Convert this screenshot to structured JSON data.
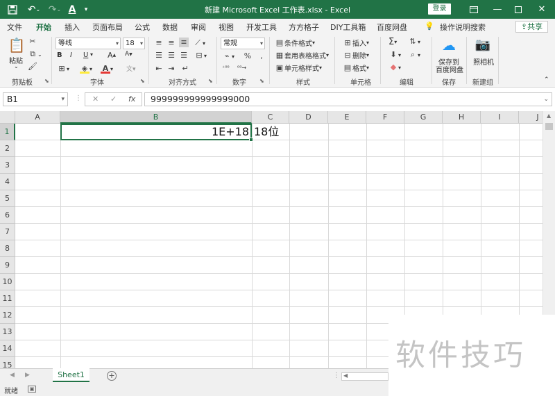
{
  "window": {
    "title": "新建 Microsoft Excel 工作表.xlsx  -  Excel",
    "login_label": "登录",
    "icons": [
      "save-icon",
      "undo-icon",
      "redo-icon",
      "font-color-icon",
      "customize-icon",
      "ribbon-display-icon",
      "minimize-icon",
      "maximize-icon",
      "close-icon"
    ]
  },
  "ribbon_tabs": [
    "文件",
    "开始",
    "插入",
    "页面布局",
    "公式",
    "数据",
    "审阅",
    "视图",
    "开发工具",
    "方方格子",
    "DIY工具箱",
    "百度网盘"
  ],
  "active_tab": "开始",
  "tell_me": "操作说明搜索",
  "share_label": "共享",
  "ribbon": {
    "clipboard": {
      "paste": "粘贴",
      "label": "剪贴板"
    },
    "font": {
      "family": "等线",
      "size": "18",
      "bold": "B",
      "italic": "I",
      "underline": "U",
      "label": "字体"
    },
    "alignment": {
      "label": "对齐方式"
    },
    "number": {
      "format": "常规",
      "label": "数字"
    },
    "styles": {
      "conditional": "条件格式",
      "table": "套用表格格式",
      "cell_styles": "单元格样式",
      "label": "样式"
    },
    "cells": {
      "insert": "插入",
      "delete": "删除",
      "format": "格式",
      "label": "单元格"
    },
    "editing": {
      "label": "编辑"
    },
    "save": {
      "button": "保存到\n百度网盘",
      "line1": "保存到",
      "line2": "百度网盘",
      "label": "保存"
    },
    "new_group": {
      "camera": "照相机",
      "label": "新建组"
    }
  },
  "formula_bar": {
    "name_box": "B1",
    "fx": "fx",
    "formula": "999999999999999000"
  },
  "grid": {
    "columns": [
      "A",
      "B",
      "C",
      "D",
      "E",
      "F",
      "G",
      "H",
      "I",
      "J"
    ],
    "rows": [
      "1",
      "2",
      "3",
      "4",
      "5",
      "6",
      "7",
      "8",
      "9",
      "10",
      "11",
      "12",
      "13",
      "14",
      "15"
    ],
    "selected_cell": "B1",
    "cells": {
      "B1": "1E+18",
      "C1": "18位"
    }
  },
  "sheets": [
    "Sheet1"
  ],
  "active_sheet": "Sheet1",
  "status": {
    "mode": "就绪"
  },
  "watermark": "软件技巧",
  "colors": {
    "accent": "#217346"
  }
}
